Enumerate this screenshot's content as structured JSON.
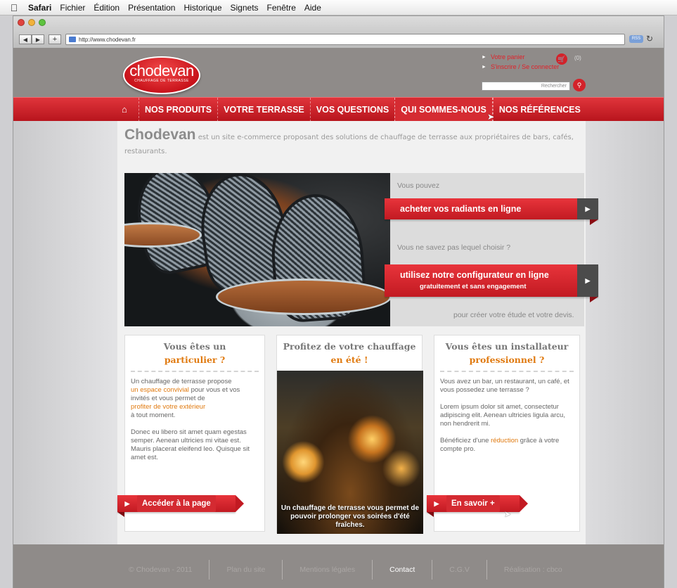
{
  "menubar": {
    "apple": "",
    "items": [
      "Safari",
      "Fichier",
      "Édition",
      "Présentation",
      "Historique",
      "Signets",
      "Fenêtre",
      "Aide"
    ]
  },
  "browser": {
    "url": "http://www.chodevan.fr",
    "rss": "RSS",
    "reload_icon": "reload-icon",
    "traffic_colors": [
      "#e0443e",
      "#f2b23b",
      "#5ec33f"
    ]
  },
  "header": {
    "logo_name": "chodevan",
    "logo_tagline": "CHAUFFAGE DE TERRASSE",
    "cart_link": "Votre panier",
    "cart_count": "(0)",
    "account_link": "S'inscrire / Se connecter",
    "search_placeholder": "Rechercher"
  },
  "nav": {
    "items": [
      "NOS PRODUITS",
      "VOTRE TERRASSE",
      "VOS QUESTIONS",
      "QUI SOMMES-NOUS",
      "NOS RÉFÉRENCES"
    ],
    "active_index": 3
  },
  "intro": {
    "brand": "Chodevan",
    "text": "est un site e-commerce proposant des solutions de chauffage de terrasse aux propriétaires de bars, cafés, restaurants."
  },
  "hero": {
    "line1": "Vous pouvez",
    "button1": "acheter vos radiants en ligne",
    "line2": "Vous ne savez pas lequel choisir ?",
    "button2_main": "utilisez notre configurateur en ligne",
    "button2_sub": "gratuitement et sans engagement",
    "line3": "pour créer votre étude et votre devis."
  },
  "cards": {
    "particulier": {
      "title1": "Vous êtes un",
      "title2": "particulier ?",
      "p1_a": "Un chauffage de terrasse propose",
      "p1_hl1": "un espace convivial",
      "p1_b": "pour vous et vos invités et vous permet de",
      "p1_hl2": "profiter de votre extérieur",
      "p1_c": "à tout moment.",
      "p2": "Donec eu libero sit amet quam egestas semper. Aenean ultricies mi vitae est. Mauris placerat eleifend leo. Quisque sit amet est.",
      "button": "Accéder à la page"
    },
    "ete": {
      "title1": "Profitez de votre chauffage",
      "title2": "en été !",
      "caption": "Un chauffage de terrasse vous permet de pouvoir prolonger vos soirées d'été fraîches."
    },
    "pro": {
      "title1": "Vous êtes un installateur",
      "title2": "professionnel ?",
      "p1": "Vous avez un bar, un restaurant, un café, et vous possedez une terrasse ?",
      "p2": "Lorem ipsum dolor sit amet, consectetur adipiscing elit. Aenean ultricies ligula arcu, non hendrerit mi.",
      "p3_a": "Bénéficiez d'une",
      "p3_hl": "réduction",
      "p3_b": "grâce à votre compte pro.",
      "button": "En savoir +"
    }
  },
  "footer": {
    "items": [
      "© Chodevan - 2011",
      "Plan du site",
      "Mentions légales",
      "Contact",
      "C.G.V",
      "Réalisation : cbco"
    ]
  },
  "colors": {
    "accent_red": "#d3222a",
    "orange": "#e07a10",
    "header_gray": "#8f8b89"
  }
}
